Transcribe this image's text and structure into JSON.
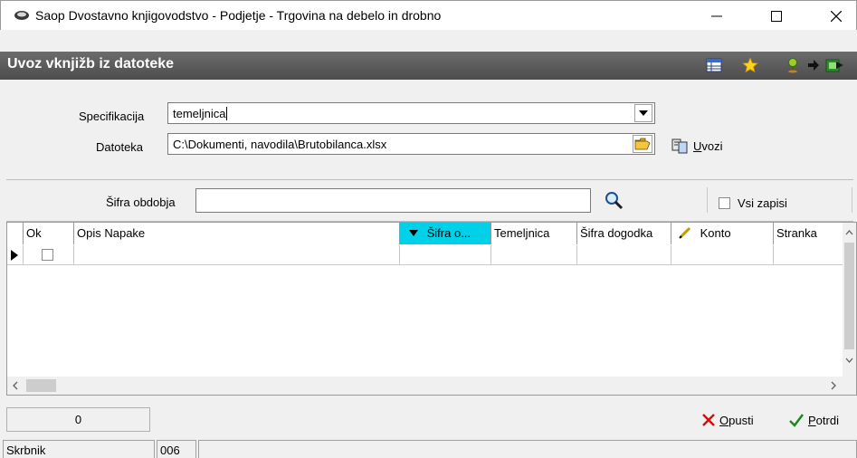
{
  "window": {
    "title": "Saop Dvostavno knjigovodstvo - Podjetje - Trgovina na debelo in drobno",
    "minimize_glyph": "—",
    "maximize_glyph": "☐",
    "close_glyph": "✕"
  },
  "header": {
    "title": "Uvoz vknjižb iz datoteke",
    "icons": [
      "table-icon",
      "star-icon",
      "map-pin-icon",
      "arrow-right-icon",
      "exit-icon"
    ]
  },
  "form": {
    "specifikacija_label": "Specifikacija",
    "specifikacija_value": "temeljnica",
    "datoteka_label": "Datoteka",
    "datoteka_value": "C:\\Dokumenti, navodila\\Brutobilanca.xlsx",
    "uvozi_label": "Uvozi",
    "uvozi_hotkey": "U",
    "uvozi_rest": "vozi"
  },
  "filter": {
    "sifra_obdobja_label": "Šifra obdobja",
    "sifra_obdobja_value": "",
    "vsi_zapisi_label": "Vsi zapisi",
    "vsi_zapisi_checked": false
  },
  "grid": {
    "columns": [
      "Ok",
      "Opis Napake",
      "Šifra o...",
      "Temeljnica",
      "Šifra dogodka",
      "Konto",
      "Stranka"
    ],
    "sorted_column": "Šifra o...",
    "rows": [
      {
        "ok": false,
        "opis": "",
        "sifra_obdobja": "",
        "temeljnica": "",
        "sifra_dogodka": "",
        "konto": "",
        "stranka": ""
      }
    ]
  },
  "footer": {
    "count": "0",
    "opusti_label": "Opusti",
    "opusti_hotkey": "O",
    "opusti_rest": "pusti",
    "potrdi_label": "Potrdi",
    "potrdi_hotkey": "P",
    "potrdi_rest": "otrdi"
  },
  "statusbar": {
    "user": "Skrbnik",
    "code": "006",
    "message": ""
  },
  "colors": {
    "header_bg": "#5a5a5a",
    "sorted_column_bg": "#00d0e8",
    "opusti_icon": "#d01010",
    "potrdi_icon": "#1a8a1a"
  }
}
